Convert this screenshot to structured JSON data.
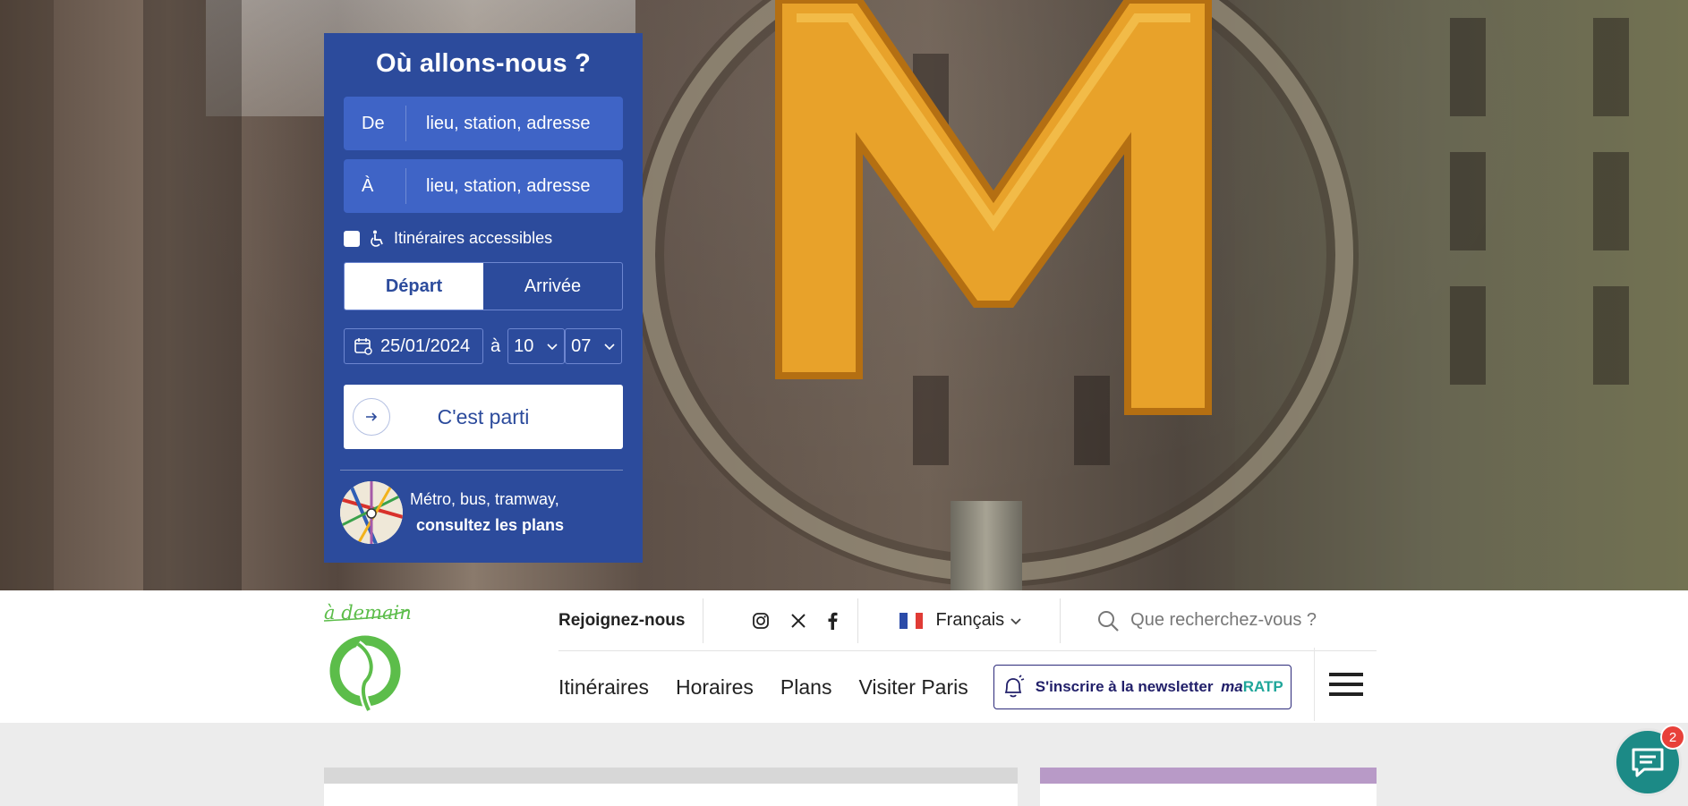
{
  "planner": {
    "title": "Où allons-nous ?",
    "from_label": "De",
    "from_placeholder": "lieu, station, adresse",
    "to_label": "À",
    "to_placeholder": "lieu, station, adresse",
    "accessible_label": "Itinéraires accessibles",
    "accessible_checked": false,
    "mode_depart": "Départ",
    "mode_arrivee": "Arrivée",
    "mode_selected": "Départ",
    "date": "25/01/2024",
    "at": "à",
    "hour": "10",
    "minute": "07",
    "submit_label": "C'est parti",
    "plans_line1": "Métro, bus, tramway,",
    "plans_line2": "consultez les plans"
  },
  "header": {
    "logo_tagline": "à demain",
    "join": "Rejoignez-nous",
    "socials": [
      "instagram-icon",
      "x-icon",
      "facebook-icon"
    ],
    "language": "Français",
    "search_placeholder": "Que recherchez-vous ?",
    "nav": [
      "Itinéraires",
      "Horaires",
      "Plans",
      "Visiter Paris"
    ],
    "newsletter_text": "S'inscrire à la newsletter",
    "newsletter_ma": "ma",
    "newsletter_ratp": "RATP"
  },
  "chat": {
    "badge": "2"
  },
  "colors": {
    "planner_bg": "#2c4b9c",
    "field_bg": "#3f64c6",
    "logo_green": "#5cbd4a",
    "chat_teal": "#1c8a86",
    "badge_red": "#e8413a",
    "card_purple": "#b89ac7"
  }
}
